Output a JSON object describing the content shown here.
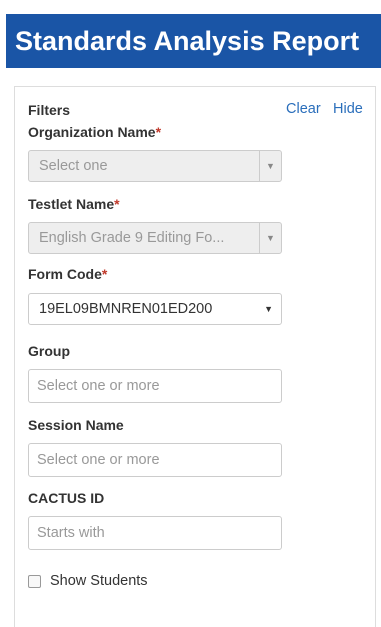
{
  "header": {
    "title": "Standards Analysis Report"
  },
  "filters": {
    "title": "Filters",
    "clear_label": "Clear",
    "hide_label": "Hide",
    "required_marker": "*",
    "organization": {
      "label": "Organization Name",
      "value": "Select one"
    },
    "testlet": {
      "label": "Testlet Name",
      "value": "English Grade 9 Editing Fo..."
    },
    "form_code": {
      "label": "Form Code",
      "value": "19EL09BMNREN01ED200"
    },
    "group": {
      "label": "Group",
      "placeholder": "Select one or more"
    },
    "session": {
      "label": "Session Name",
      "placeholder": "Select one or more"
    },
    "cactus": {
      "label": "CACTUS ID",
      "placeholder": "Starts with"
    },
    "show_students": {
      "label": "Show Students",
      "checked": false
    }
  }
}
